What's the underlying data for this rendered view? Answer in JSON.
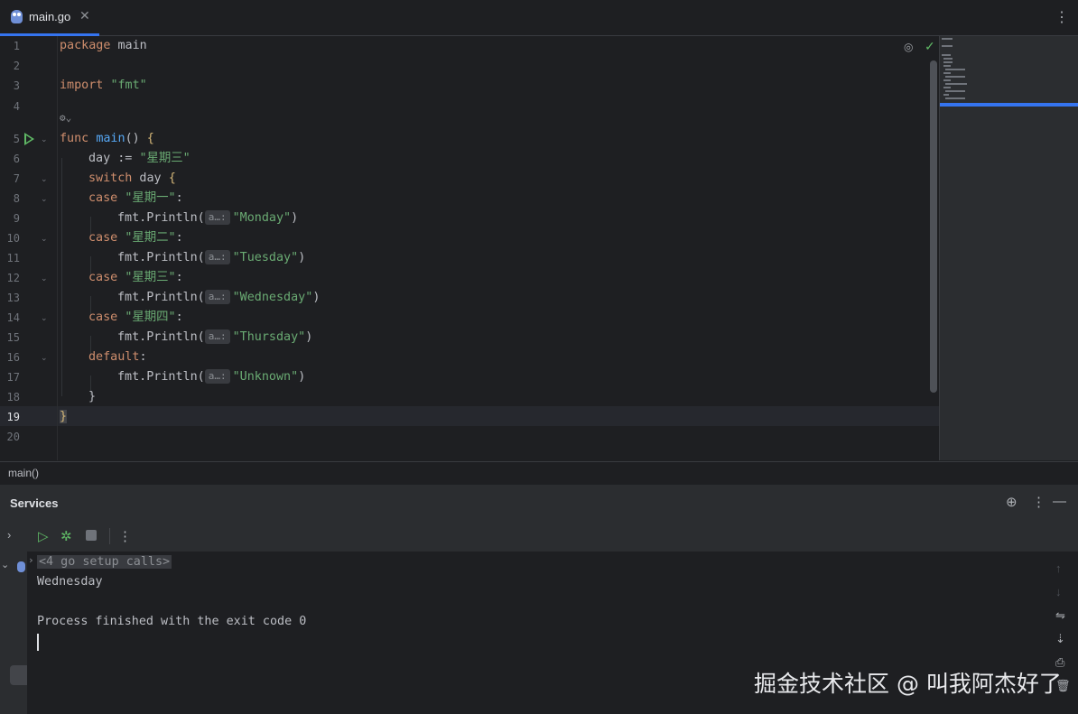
{
  "tab": {
    "filename": "main.go",
    "close_icon": "close-icon"
  },
  "editor": {
    "line_numbers": [
      "1",
      "2",
      "3",
      "4",
      "5",
      "6",
      "7",
      "8",
      "9",
      "10",
      "11",
      "12",
      "13",
      "14",
      "15",
      "16",
      "17",
      "18",
      "19",
      "20"
    ],
    "current_line": "19",
    "inlay_hint": "a…:",
    "lines": {
      "l1_kw": "package",
      "l1_rest": " main",
      "l3_kw": "import",
      "l3_str": "\"fmt\"",
      "l5_kw": "func",
      "l5_fn": "main",
      "l5_rest": "() ",
      "l5_brace": "{",
      "l6_a": "day := ",
      "l6_str": "\"星期三\"",
      "l7_kw": "switch",
      "l7_rest": " day ",
      "l7_brace": "{",
      "l8_kw": "case",
      "l8_str": "\"星期一\"",
      "colon": ":",
      "l9_call": "fmt.Println(",
      "l9_str": "\"Monday\"",
      "close_paren": ")",
      "l10_str": "\"星期二\"",
      "l11_str": "\"Tuesday\"",
      "l12_str": "\"星期三\"",
      "l13_str": "\"Wednesday\"",
      "l14_str": "\"星期四\"",
      "l15_str": "\"Thursday\"",
      "l16_kw": "default",
      "l17_str": "\"Unknown\"",
      "l18_brace": "}",
      "l19_brace": "}"
    }
  },
  "breadcrumb": "main()",
  "services": {
    "title": "Services",
    "console": {
      "setup_calls": "<4 go setup calls>",
      "output": "Wednesday",
      "exit_message": "Process finished with the exit code 0"
    }
  },
  "watermark": "掘金技术社区 @ 叫我阿杰好了",
  "colors": {
    "accent": "#3574f0",
    "run_green": "#5fb865",
    "keyword": "#cf8e6d",
    "string": "#6aab73",
    "function": "#56a8f5"
  }
}
